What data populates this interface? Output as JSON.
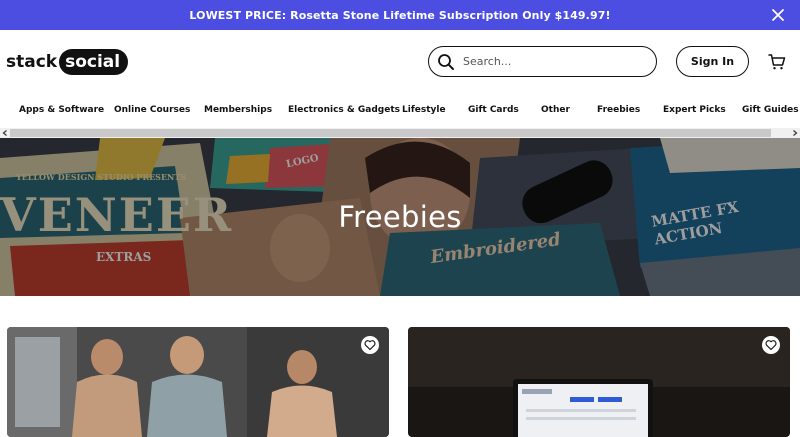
{
  "promo": {
    "text": "LOWEST PRICE: Rosetta Stone Lifetime Subscription Only $149.97!",
    "close_icon": "close-icon",
    "bg_color": "#4b4ee0"
  },
  "header": {
    "logo_left": "stack",
    "logo_right": "social",
    "search_placeholder": "Search...",
    "signin_label": "Sign In",
    "cart_icon": "cart-icon"
  },
  "nav": {
    "items": [
      {
        "label": "Apps & Software"
      },
      {
        "label": "Online Courses"
      },
      {
        "label": "Memberships"
      },
      {
        "label": "Electronics & Gadgets"
      },
      {
        "label": "Lifestyle"
      },
      {
        "label": "Gift Cards"
      },
      {
        "label": "Other"
      },
      {
        "label": "Freebies"
      },
      {
        "label": "Expert Picks"
      },
      {
        "label": "Gift Guides"
      }
    ]
  },
  "hero": {
    "title": "Freebies",
    "art": {
      "logo_tag": "LOGO",
      "studio_text": "YELLOW DESIGN STUDIO PRESENTS",
      "big_word": "VENEER",
      "extras": "EXTRAS",
      "embroidered": "Embroidered",
      "matte": "MATTE FX ACTION"
    }
  },
  "cards": [
    {
      "favorite_icon": "heart-icon"
    },
    {
      "favorite_icon": "heart-icon"
    }
  ]
}
